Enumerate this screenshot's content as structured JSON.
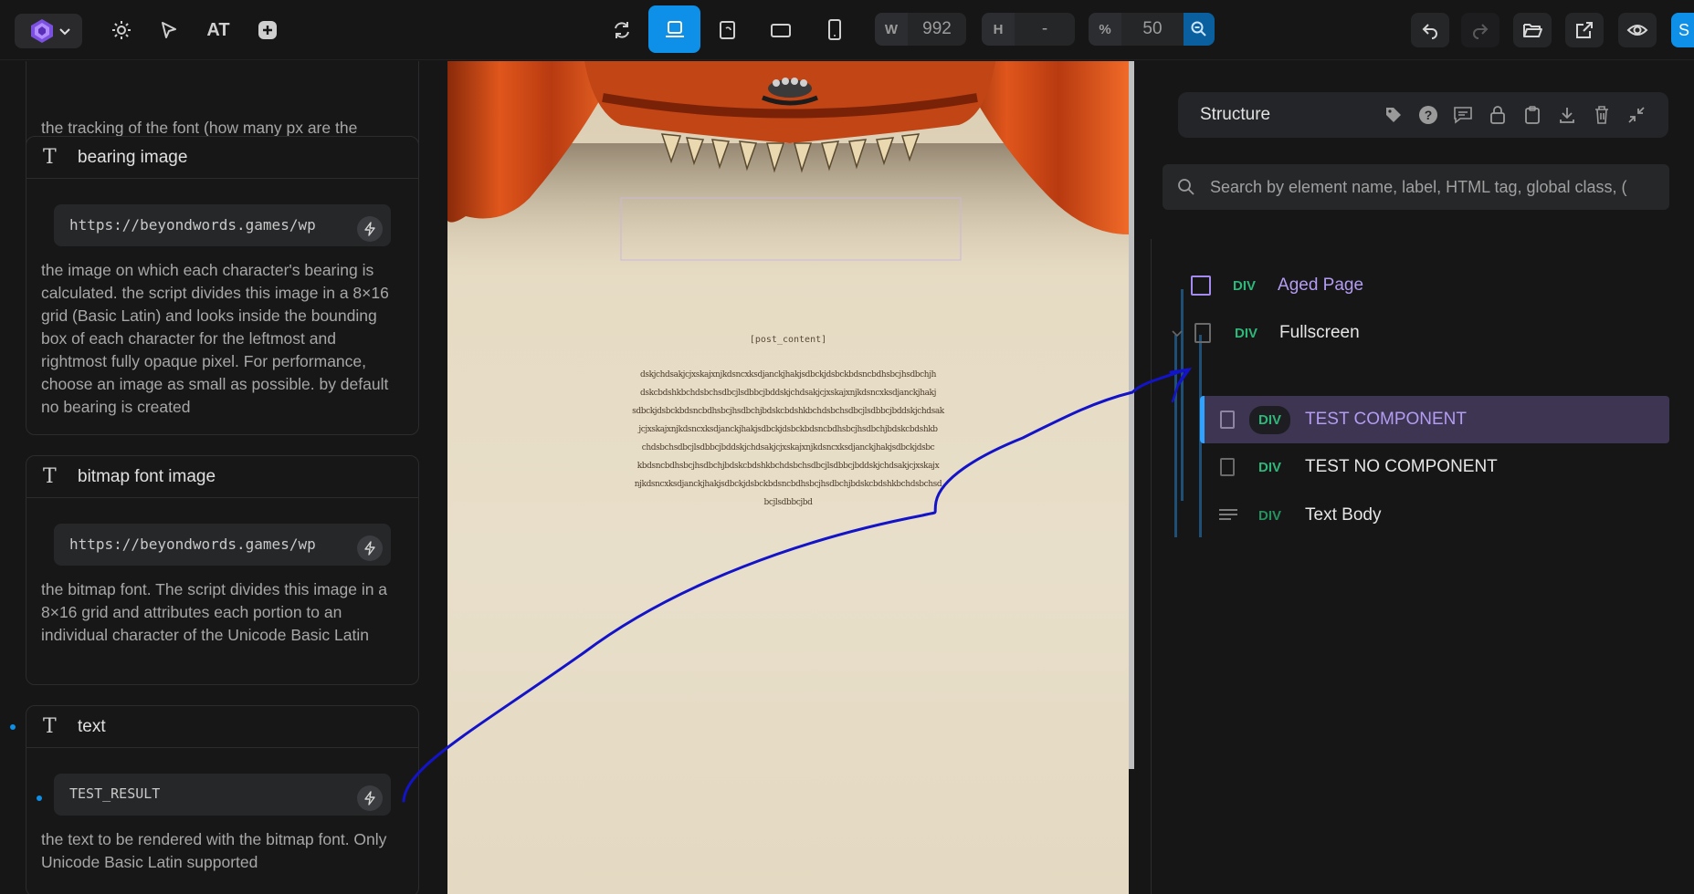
{
  "toolbar": {
    "at_label": "AT",
    "width_label": "W",
    "width_value": "992",
    "height_label": "H",
    "height_value": "-",
    "zoom_label": "%",
    "zoom_value": "50",
    "edge_button_label": "S"
  },
  "settings_panel": {
    "tracking_desc": "the tracking of the font (how many px are the characters spaced one to the other)",
    "bearing": {
      "title": "bearing image",
      "value": "https://beyondwords.games/wp",
      "desc": "the image on which each character's bearing is calculated. the script divides this image in a 8×16 grid (Basic Latin) and looks inside the bounding box of each character for the leftmost and rightmost fully opaque pixel. For performance, choose an image as small as possible. by default no bearing is created"
    },
    "bitmap": {
      "title": "bitmap font image",
      "value": "https://beyondwords.games/wp",
      "desc": "the bitmap font. The script divides this image in a 8×16 grid and attributes each portion to an individual character of the Unicode Basic Latin"
    },
    "text": {
      "title": "text",
      "value": "TEST_RESULT",
      "desc": "the text to be rendered with the bitmap font. Only Unicode Basic Latin supported"
    }
  },
  "canvas": {
    "post_content_label": "[post_content]",
    "gibberish_lines": [
      "dskjchdsakjcjxskajxnjkdsncxksdjanckjhakjsdbckjdsbckbdsncbdhsbcjhsdbchjh",
      "dskcbdshkbchdsbchsdbcjlsdbbcjbddskjchdsakjcjxskajxnjkdsncxksdjanckjhakj",
      "sdbckjdsbckbdsncbdhsbcjhsdbchjbdskcbdshkbchdsbchsdbcjlsdbbcjbddskjchdsak",
      "jcjxskajxnjkdsncxksdjanckjhakjsdbckjdsbckbdsncbdhsbcjhsdbchjbdskcbdshkb",
      "chdsbchsdbcjlsdbbcjbddskjchdsakjcjxskajxnjkdsncxksdjanckjhakjsdbckjdsbc",
      "kbdsncbdhsbcjhsdbchjbdskcbdshkbchdsbchsdbcjlsdbbcjbddskjchdsakjcjxskajx",
      "njkdsncxksdjanckjhakjsdbckjdsbckbdsncbdhsbcjhsdbchjbdskcbdshkbchdsbchsd",
      "bcjlsdbbcjbd"
    ]
  },
  "structure_panel": {
    "title": "Structure",
    "search_placeholder": "Search by element name, label, HTML tag, global class, (",
    "items": [
      {
        "tag": "DIV",
        "label": "Aged Page"
      },
      {
        "tag": "DIV",
        "label": "Fullscreen"
      },
      {
        "tag": "DIV",
        "label": "TEST COMPONENT"
      },
      {
        "tag": "DIV",
        "label": "TEST NO COMPONENT"
      },
      {
        "tag": "DIV",
        "label": "Text Body"
      }
    ]
  },
  "colors": {
    "accent_blue": "#0e90e8",
    "selected_row": "#3d3552",
    "component_purple": "#b39cf2",
    "tag_green": "#2fb779",
    "annotation_stroke": "#1313c8"
  }
}
